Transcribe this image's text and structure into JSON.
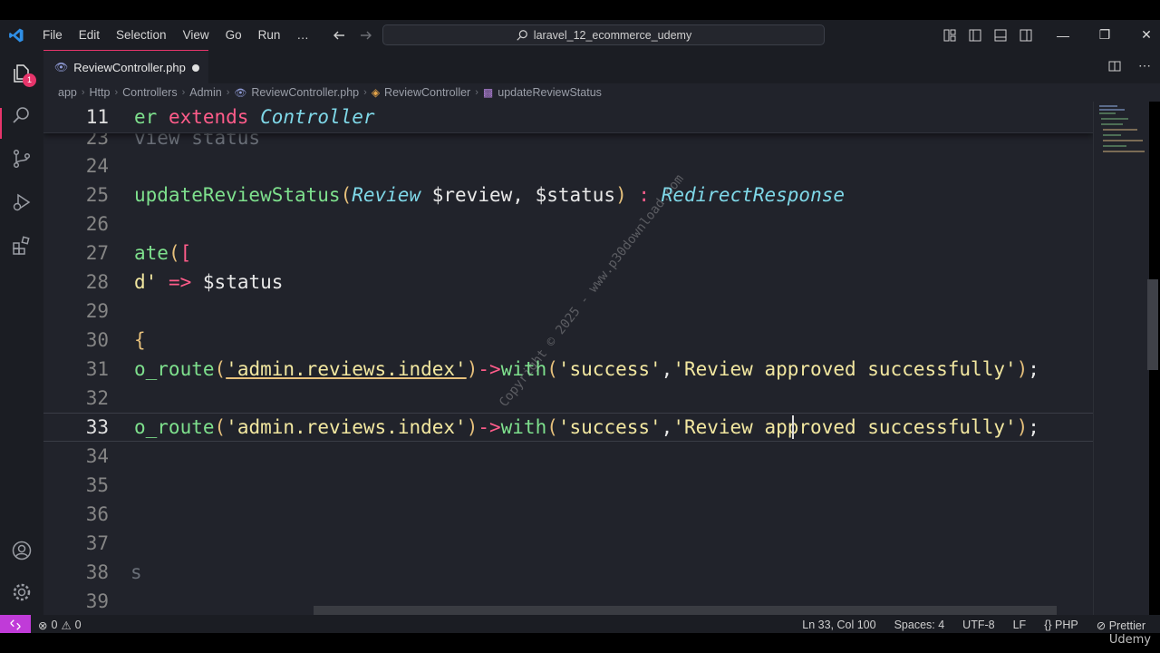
{
  "window": {
    "search_text": "laravel_12_ecommerce_udemy",
    "menu": [
      "File",
      "Edit",
      "Selection",
      "View",
      "Go",
      "Run",
      "…"
    ]
  },
  "activity_bar": {
    "explorer_badge": "1"
  },
  "tab": {
    "label": "ReviewController.php",
    "modified": true
  },
  "breadcrumb": [
    "app",
    "Http",
    "Controllers",
    "Admin",
    "ReviewController.php",
    "ReviewController",
    "updateReviewStatus"
  ],
  "editor": {
    "sticky": {
      "number": "11",
      "text": "er extends Controller"
    },
    "lines": [
      {
        "number": "23",
        "text": "view status"
      },
      {
        "number": "24",
        "text": ""
      },
      {
        "number": "25",
        "text": "updateReviewStatus(Review $review, $status) : RedirectResponse"
      },
      {
        "number": "26",
        "text": ""
      },
      {
        "number": "27",
        "text": "ate(["
      },
      {
        "number": "28",
        "text": "d' => $status"
      },
      {
        "number": "29",
        "text": ""
      },
      {
        "number": "30",
        "text": "{"
      },
      {
        "number": "31",
        "text": "o_route('admin.reviews.index')->with('success','Review approved successfully');"
      },
      {
        "number": "32",
        "text": ""
      },
      {
        "number": "33",
        "text": "o_route('admin.reviews.index')->with('success','Review approved successfully');"
      },
      {
        "number": "34",
        "text": ""
      },
      {
        "number": "35",
        "text": ""
      },
      {
        "number": "36",
        "text": ""
      },
      {
        "number": "37",
        "text": ""
      },
      {
        "number": "38",
        "text": "s"
      },
      {
        "number": "39",
        "text": ""
      }
    ],
    "active_line": "33"
  },
  "watermark": "Copyright © 2025 - www.p30download.com",
  "statusbar": {
    "errors": "0",
    "warnings": "0",
    "position": "Ln 33, Col 100",
    "spaces": "Spaces: 4",
    "encoding": "UTF-8",
    "eol": "LF",
    "language": "PHP",
    "formatter": "Prettier"
  },
  "overlay": {
    "brand": "Udemy"
  },
  "colors": {
    "accent": "#e7356b",
    "remote": "#c03bd8",
    "editor_bg": "#21232b",
    "keyword": "#ff5c8a",
    "function": "#7ee08d",
    "class": "#7fd8e8",
    "string": "#f2e7a0"
  }
}
